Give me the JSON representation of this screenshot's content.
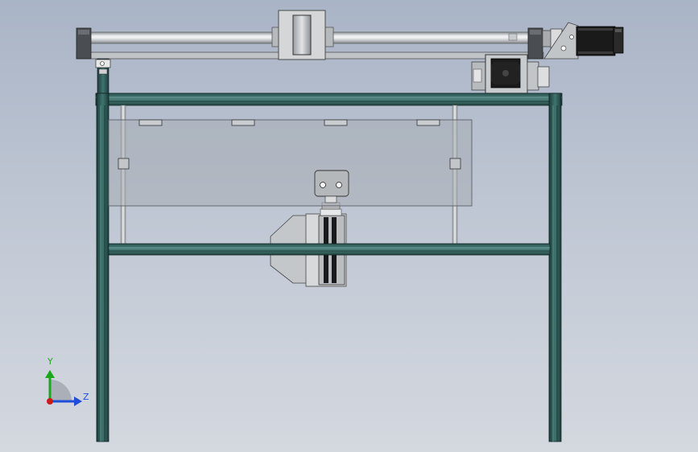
{
  "viewport": {
    "background_top": "#a9b4c6",
    "background_bottom": "#d4d8df"
  },
  "model": {
    "frame_color": "#2f5b57",
    "glass_color": "#a7adb5",
    "rail_color": "#d8dadc",
    "motor_color": "#1a1a1a"
  },
  "triad": {
    "y_label": "Y",
    "z_label": "Z",
    "y_color": "#1aa81a",
    "z_color": "#1f4fd8",
    "x_color": "#d01818"
  }
}
